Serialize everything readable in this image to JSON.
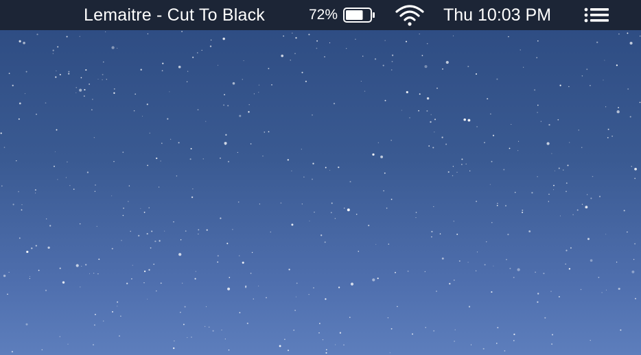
{
  "menubar": {
    "now_playing": "Lemaitre - Cut To Black",
    "battery": {
      "percent_label": "72%",
      "level": 0.72,
      "icon": "battery-icon"
    },
    "wifi": {
      "icon": "wifi-icon"
    },
    "clock": "Thu 10:03 PM",
    "menu_icon": "list-icon"
  },
  "desktop": {
    "wallpaper": "starry-night",
    "colors": {
      "menubar_bg": "#1c2536",
      "sky_top": "#2c4a80",
      "sky_bottom": "#5d7ebc",
      "text": "#ffffff"
    }
  }
}
